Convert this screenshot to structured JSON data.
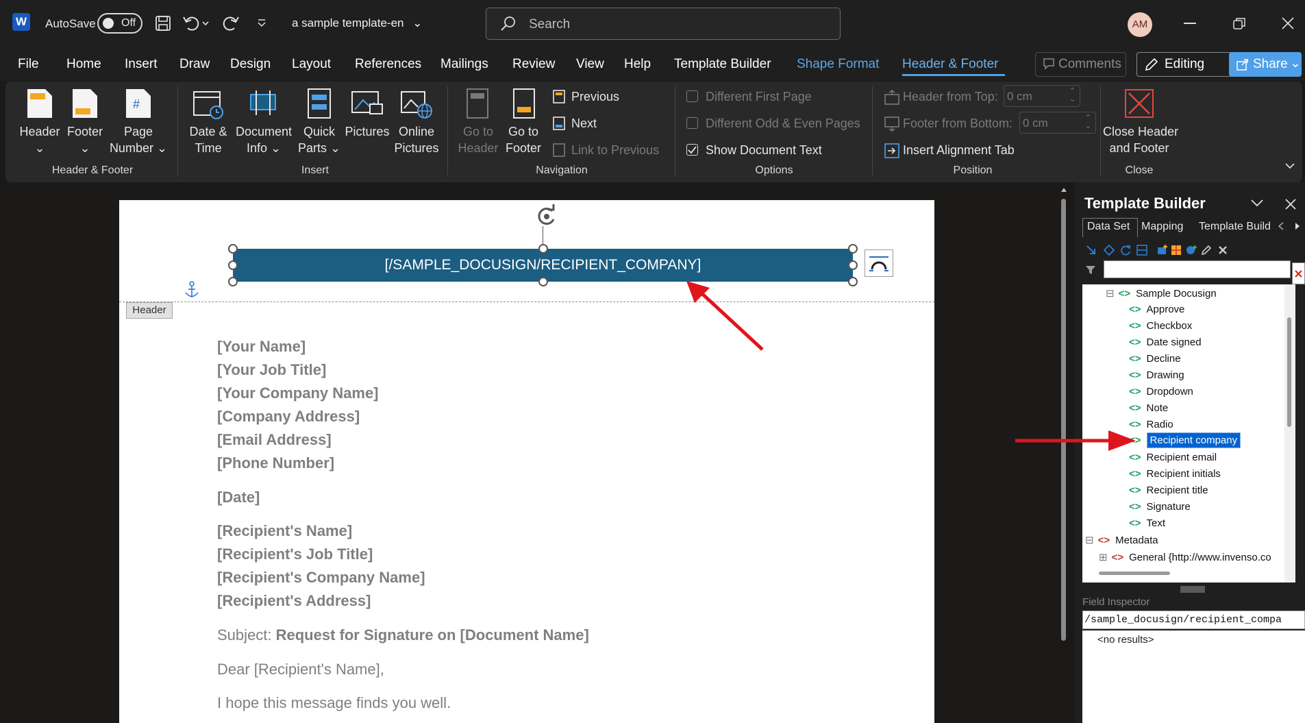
{
  "titlebar": {
    "autosave_label": "AutoSave",
    "toggle_state": "Off",
    "document_title": "a sample template-en",
    "search_placeholder": "Search",
    "avatar_initials": "AM"
  },
  "menu": {
    "tabs": [
      "File",
      "Home",
      "Insert",
      "Draw",
      "Design",
      "Layout",
      "References",
      "Mailings",
      "Review",
      "View",
      "Help",
      "Template Builder",
      "Shape Format",
      "Header & Footer"
    ],
    "active_tab": "Header & Footer",
    "comments_label": "Comments",
    "editing_label": "Editing",
    "share_label": "Share"
  },
  "ribbon": {
    "header_footer": {
      "header": "Header",
      "footer": "Footer",
      "page": "Page",
      "number": "Number",
      "group": "Header & Footer"
    },
    "insert": {
      "date": "Date &",
      "time": "Time",
      "document": "Document",
      "info": "Info",
      "quick": "Quick",
      "parts": "Parts",
      "pictures": "Pictures",
      "online": "Online",
      "online_pictures": "Pictures",
      "group": "Insert"
    },
    "navigation": {
      "goto": "Go to",
      "header": "Header",
      "goto2": "Go to",
      "footer": "Footer",
      "previous": "Previous",
      "next": "Next",
      "link": "Link to Previous",
      "group": "Navigation"
    },
    "options": {
      "different_first": "Different First Page",
      "different_odd_even": "Different Odd & Even Pages",
      "show_doc_text": "Show Document Text",
      "group": "Options"
    },
    "position": {
      "header_from_top": "Header from Top:",
      "header_value": "0 cm",
      "footer_from_bottom": "Footer from Bottom:",
      "footer_value": "0 cm",
      "alignment_tab": "Insert Alignment Tab",
      "group": "Position"
    },
    "close": {
      "close1": "Close Header",
      "close2": "and Footer",
      "group": "Close"
    }
  },
  "document": {
    "header_field": "[/SAMPLE_DOCUSIGN/RECIPIENT_COMPANY]",
    "header_tag": "Header",
    "sender_block": [
      "[Your Name]",
      "[Your Job Title]",
      "[Your Company Name]",
      "[Company Address]",
      "[Email Address]",
      "[Phone Number]"
    ],
    "date": "[Date]",
    "recipient_block": [
      "[Recipient's Name]",
      "[Recipient's Job Title]",
      "[Recipient's Company Name]",
      "[Recipient's Address]"
    ],
    "subject_label": "Subject:",
    "subject_value": "Request for Signature on [Document Name]",
    "salutation": "Dear [Recipient's Name],",
    "body_first": "I hope this message finds you well."
  },
  "template_builder": {
    "title": "Template Builder",
    "tabs": [
      "Data Set",
      "Mapping",
      "Template Build"
    ],
    "root": "Sample Docusign",
    "fields": [
      "Approve",
      "Checkbox",
      "Date signed",
      "Decline",
      "Drawing",
      "Dropdown",
      "Note",
      "Radio",
      "Recipient company",
      "Recipient email",
      "Recipient initials",
      "Recipient title",
      "Signature",
      "Text"
    ],
    "selected_field": "Recipient company",
    "metadata": "Metadata",
    "general": "General {http://www.invenso.co",
    "field_inspector": "Field Inspector",
    "xpath": "/sample_docusign/recipient_compa",
    "results": "<no results>"
  },
  "colors": {
    "header_field_fill": "#1b5e82",
    "selection": "#0063d1",
    "annotation_arrow": "#e0141c",
    "share_button": "#4fa0e8"
  }
}
